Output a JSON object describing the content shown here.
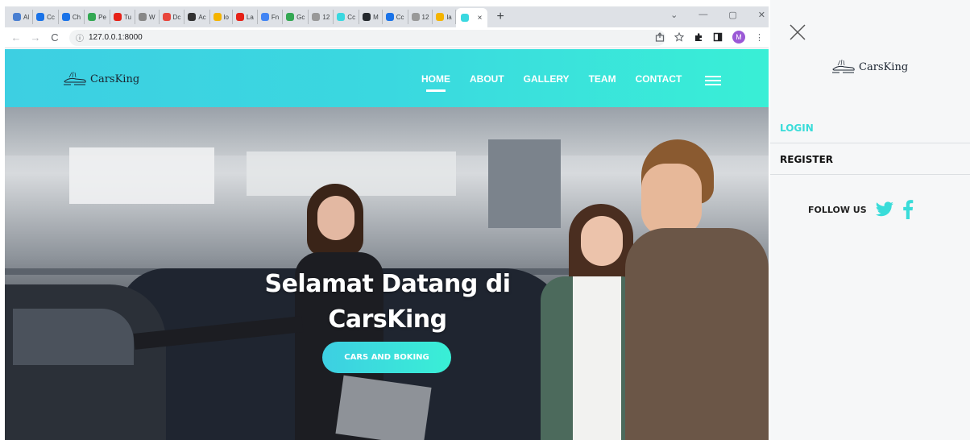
{
  "browser": {
    "tabs": [
      {
        "label": "Al",
        "color": "#4a7fd1"
      },
      {
        "label": "Cc",
        "color": "#1a73e8"
      },
      {
        "label": "Ch",
        "color": "#1a73e8"
      },
      {
        "label": "Pe",
        "color": "#34a853"
      },
      {
        "label": "Tu",
        "color": "#e62117"
      },
      {
        "label": "W",
        "color": "#888888"
      },
      {
        "label": "Dc",
        "color": "#e8453c"
      },
      {
        "label": "Ac",
        "color": "#333333"
      },
      {
        "label": "lo",
        "color": "#f4b400"
      },
      {
        "label": "La",
        "color": "#e62117"
      },
      {
        "label": "Fn",
        "color": "#4285f4"
      },
      {
        "label": "Gc",
        "color": "#34a853"
      },
      {
        "label": "12",
        "color": "#999999"
      },
      {
        "label": "Cc",
        "color": "#3ad8e0"
      },
      {
        "label": "M",
        "color": "#24292e"
      },
      {
        "label": "Cc",
        "color": "#1a73e8"
      },
      {
        "label": "12",
        "color": "#999999"
      },
      {
        "label": "la",
        "color": "#f4b400"
      }
    ],
    "active_tab_close": "×",
    "new_tab": "+",
    "window_controls": {
      "menu": "⌄",
      "minimize": "—",
      "restore": "▢",
      "close": "✕"
    },
    "nav": {
      "back": "←",
      "forward": "→",
      "reload": "C"
    },
    "url": "127.0.0.1:8000",
    "url_icon": "ⓘ",
    "profile_initial": "M"
  },
  "site": {
    "logo_text": "CarsKing",
    "nav": [
      {
        "label": "HOME",
        "active": true
      },
      {
        "label": "ABOUT",
        "active": false
      },
      {
        "label": "GALLERY",
        "active": false
      },
      {
        "label": "TEAM",
        "active": false
      },
      {
        "label": "CONTACT",
        "active": false
      }
    ],
    "hero": {
      "title_line1": "Selamat Datang di",
      "title_line2": "CarsKing",
      "button": "CARS AND BOKING"
    }
  },
  "sidepanel": {
    "logo_text": "CarsKing",
    "login": "LOGIN",
    "register": "REGISTER",
    "follow_label": "FOLLOW US",
    "social": [
      "twitter-icon",
      "facebook-icon"
    ]
  },
  "colors": {
    "accent": "#3ad8e0",
    "accent_gradient_end": "#39efd6",
    "panel_bg": "#f6f7f8"
  }
}
